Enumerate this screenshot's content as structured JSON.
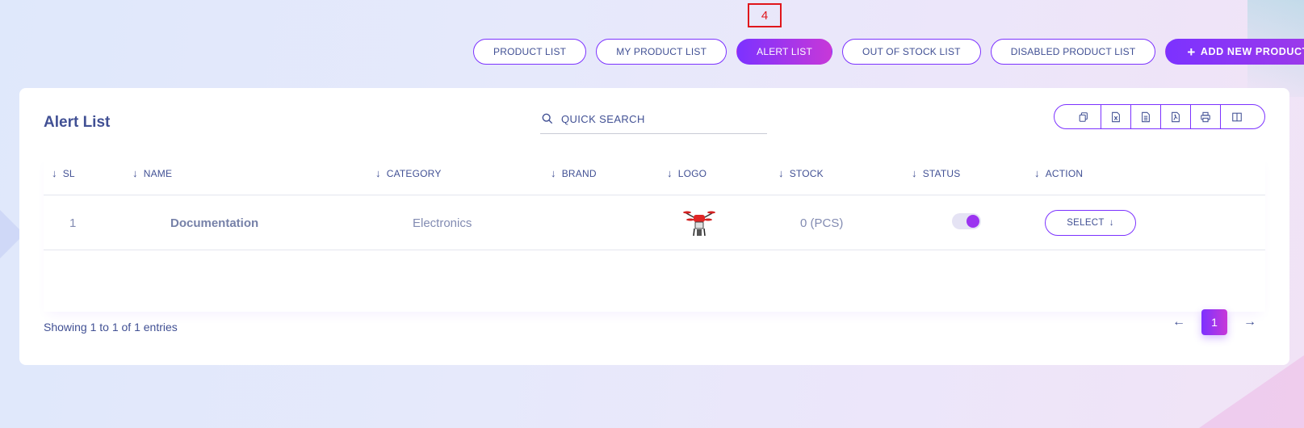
{
  "marker": {
    "label": "4"
  },
  "nav": {
    "product_list": "PRODUCT LIST",
    "my_product_list": "MY PRODUCT LIST",
    "alert_list": "ALERT LIST",
    "out_of_stock_list": "OUT OF STOCK LIST",
    "disabled_product_list": "DISABLED PRODUCT LIST",
    "add_new_product": "ADD NEW PRODUCT",
    "active": "alert_list"
  },
  "card": {
    "title": "Alert List",
    "search": {
      "placeholder": "QUICK SEARCH"
    },
    "export_icons": [
      "copy-icon",
      "excel-icon",
      "csv-icon",
      "pdf-icon",
      "print-icon",
      "columns-icon"
    ]
  },
  "table": {
    "headers": {
      "sl": "SL",
      "name": "NAME",
      "category": "CATEGORY",
      "brand": "BRAND",
      "logo": "LOGO",
      "stock": "STOCK",
      "status": "STATUS",
      "action": "ACTION"
    },
    "rows": [
      {
        "sl": "1",
        "name": "Documentation",
        "category": "Electronics",
        "brand": "",
        "logo": "drone-image",
        "stock": "0 (PCS)",
        "status_on": true,
        "action": "SELECT"
      }
    ]
  },
  "footer": {
    "entries": "Showing 1 to 1 of 1 entries",
    "current_page": "1",
    "prev_icon": "arrow-left-icon",
    "next_icon": "arrow-right-icon"
  },
  "colors": {
    "accent": "#7c32ff",
    "accent_end": "#c738d8",
    "text": "#415094",
    "muted": "#828bb2",
    "marker": "#e0161b"
  }
}
